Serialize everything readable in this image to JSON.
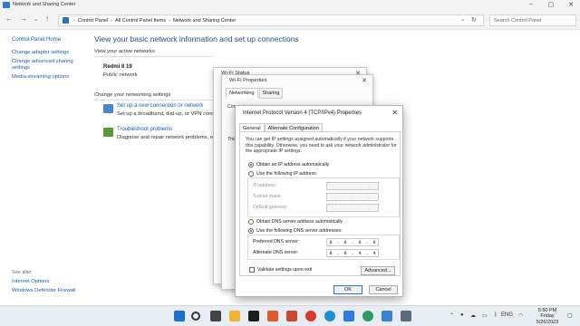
{
  "window": {
    "title": "Network and Sharing Center"
  },
  "address": {
    "crumbs": [
      "Control Panel",
      "All Control Panel Items",
      "Network and Sharing Center"
    ],
    "search_placeholder": "Search Control Panel"
  },
  "left_pane": {
    "home": "Control Panel Home",
    "links": [
      "Change adapter settings",
      "Change advanced sharing settings",
      "Media streaming options"
    ],
    "see_also_header": "See also",
    "see_also": [
      "Internet Options",
      "Windows Defender Firewall"
    ]
  },
  "main": {
    "title": "View your basic network information and set up connections",
    "active_networks": "View your active networks",
    "network_name": "Redmi 8 19",
    "network_type": "Public network",
    "change_settings": "Change your networking settings",
    "tasks": [
      {
        "link": "Set up a new connection or network",
        "desc": "Set up a broadband, dial-up, or VPN connec"
      },
      {
        "link": "Troubleshoot problems",
        "desc": "Diagnose and repair network problems, or"
      }
    ]
  },
  "wifi_status": {
    "title": "Wi-Fi Status"
  },
  "wifi_properties": {
    "title": "Wi-Fi Properties",
    "tabs": [
      "Networking",
      "Sharing"
    ],
    "fragment_connect": "Connect using:",
    "fragment_this": "This"
  },
  "ipv4": {
    "title": "Internet Protocol Version 4 (TCP/IPv4) Properties",
    "tabs": [
      "General",
      "Alternate Configuration"
    ],
    "description": "You can get IP settings assigned automatically if your network supports this capability. Otherwise, you need to ask your network administrator for the appropriate IP settings.",
    "obtain_ip": "Obtain an IP address automatically",
    "use_ip": "Use the following IP address:",
    "ip_address": "IP address:",
    "subnet_mask": "Subnet mask:",
    "default_gateway": "Default gateway:",
    "obtain_dns": "Obtain DNS server address automatically",
    "use_dns": "Use the following DNS server addresses:",
    "preferred_dns": "Preferred DNS server:",
    "preferred_dns_value": [
      "8",
      "8",
      "8",
      "8"
    ],
    "alternate_dns": "Alternate DNS server:",
    "alternate_dns_value": [
      "8",
      "8",
      "4",
      "4"
    ],
    "validate": "Validate settings upon exit",
    "advanced": "Advanced...",
    "ok": "OK",
    "cancel": "Cancel",
    "dot": "."
  },
  "taskbar": {
    "lang": "ENG",
    "time": "5:50 PM",
    "day": "Friday",
    "date": "5/26/2023"
  },
  "colors": {
    "accent": "#1a5fb4",
    "title_blue": "#1f4e99"
  }
}
